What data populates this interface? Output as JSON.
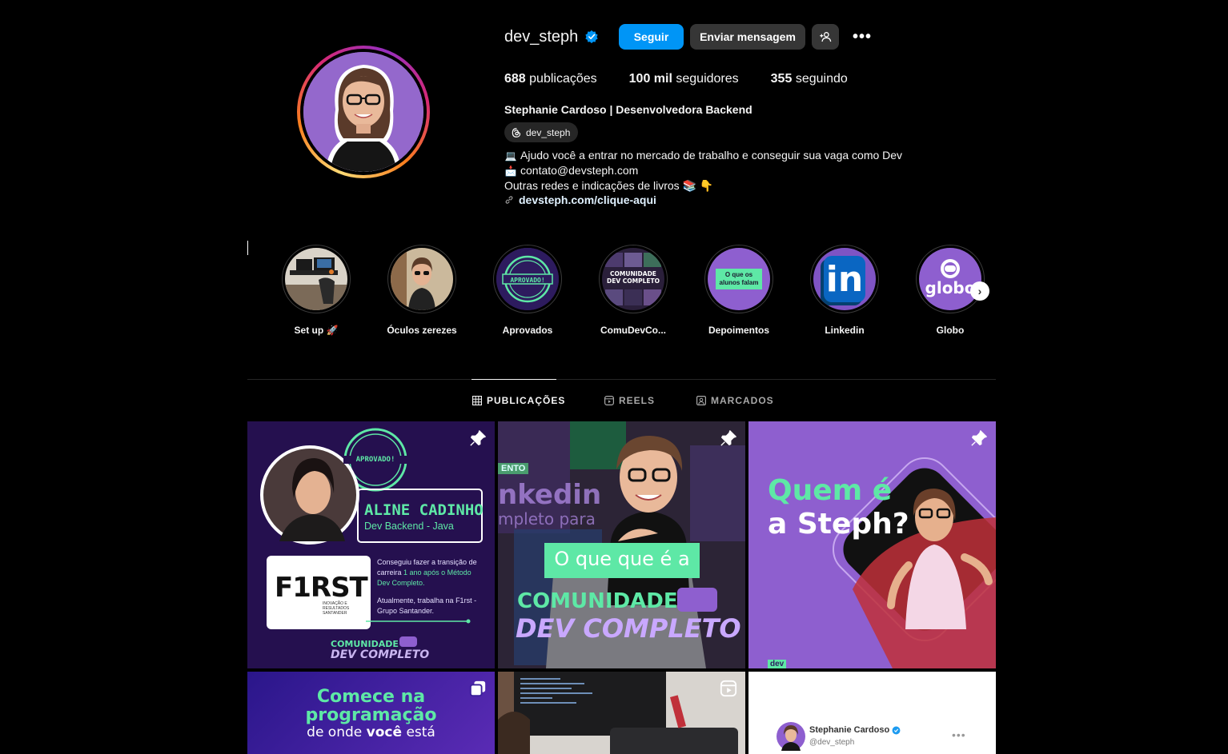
{
  "profile": {
    "username": "dev_steph",
    "follow_label": "Seguir",
    "message_label": "Enviar mensagem",
    "more_label": "•••",
    "stats": {
      "posts_count": "688",
      "posts_label": "publicações",
      "followers_count": "100 mil",
      "followers_label": "seguidores",
      "following_count": "355",
      "following_label": "seguindo"
    },
    "full_name": "Stephanie Cardoso | Desenvolvedora Backend",
    "threads_handle": "dev_steph",
    "bio_lines": [
      {
        "icon": "💻",
        "text": "Ajudo você a entrar no mercado de trabalho e conseguir sua vaga como Dev"
      },
      {
        "icon": "📩",
        "text": "contato@devsteph.com"
      },
      {
        "icon": "",
        "text": "Outras redes e indicações de livros 📚 👇"
      }
    ],
    "bio_link": "devsteph.com/clique-aqui"
  },
  "highlights": [
    {
      "label": "Set up 🚀",
      "icon": "desk-setup"
    },
    {
      "label": "Óculos zerezes",
      "icon": "glasses-photo"
    },
    {
      "label": "Aprovados",
      "icon": "approved-stamp",
      "art_text": "APROVADO!"
    },
    {
      "label": "ComuDevCo...",
      "icon": "community-cover",
      "art_text": "COMUNIDADE DEV COMPLETO"
    },
    {
      "label": "Depoimentos",
      "icon": "testimonials",
      "art_text": "O que os alunos falam"
    },
    {
      "label": "Linkedin",
      "icon": "linkedin-logo",
      "art_text": "in"
    },
    {
      "label": "Globo",
      "icon": "globo-logo",
      "art_text": "globo"
    }
  ],
  "tabs": [
    {
      "label": "PUBLICAÇÕES",
      "icon": "grid-icon",
      "active": true
    },
    {
      "label": "REELS",
      "icon": "reels-icon",
      "active": false
    },
    {
      "label": "MARCADOS",
      "icon": "tagged-icon",
      "active": false
    }
  ],
  "posts": {
    "p1": {
      "stamp": "APROVADO!",
      "name": "ALINE CADINHO",
      "role": "Dev Backend - Java",
      "company": "F1RST",
      "company_sub": "INOVAÇÃO E RESULTADOS SANTANDER",
      "text1_a": "Conseguiu fazer a transição de carreira",
      "text1_b": "1 ano após o Método Dev Completo.",
      "text2": "Atualmente, trabalha na F1rst - Grupo Santander.",
      "brand_1": "COMUNIDADE",
      "brand_2": "DEV COMPLETO"
    },
    "p2": {
      "bg_text_1": "ENTO",
      "bg_text_2": "nkedin",
      "bg_text_3": "mpleto para",
      "caption_1": "O que que é a",
      "caption_2": "COMUNIDADE",
      "caption_3": "DEV COMPLETO"
    },
    "p3": {
      "title_1": "Quem é",
      "title_2": "a Steph?",
      "corner": "dev"
    },
    "p4": {
      "line_1": "Comece na",
      "line_2": "programação",
      "line_3a": "de onde",
      "line_3b": "você",
      "line_3c": "está"
    },
    "p6": {
      "name": "Stephanie Cardoso",
      "handle": "@dev_steph",
      "more": "•••"
    }
  },
  "colors": {
    "follow_blue": "#0095f6",
    "accent_green": "#5ee8a6",
    "brand_purple": "#8e5fcf"
  }
}
